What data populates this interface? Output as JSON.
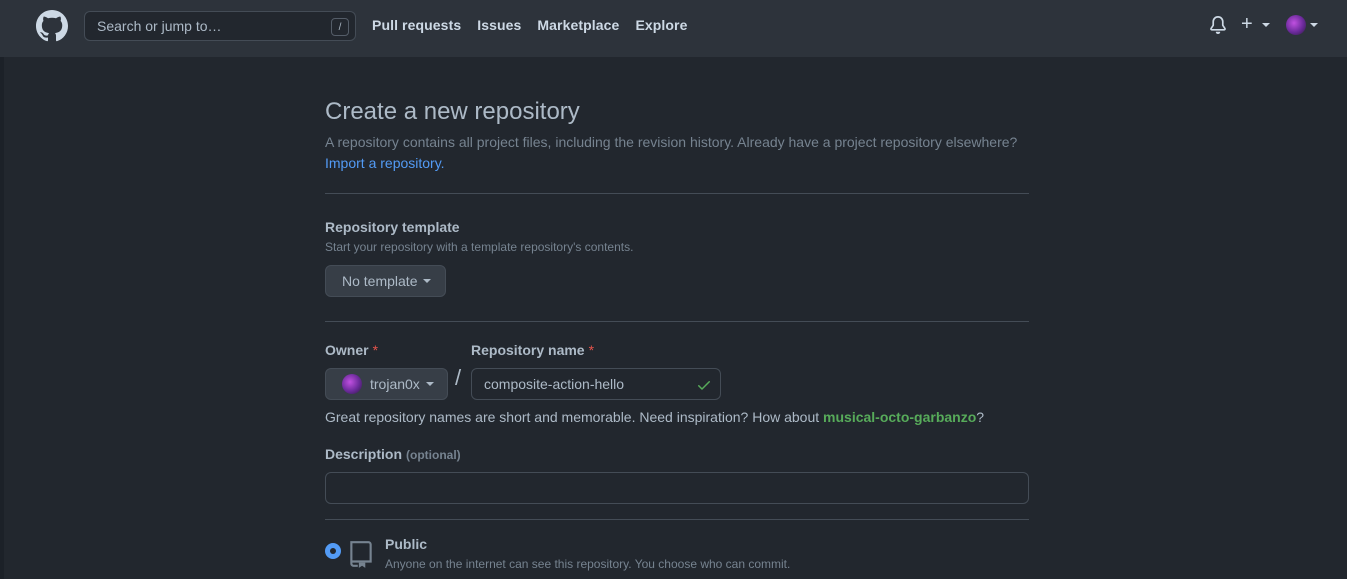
{
  "header": {
    "search_placeholder": "Search or jump to…",
    "search_shortcut": "/",
    "nav": [
      "Pull requests",
      "Issues",
      "Marketplace",
      "Explore"
    ],
    "plus": "+"
  },
  "page": {
    "title": "Create a new repository",
    "subtitle": "A repository contains all project files, including the revision history. Already have a project repository elsewhere?",
    "import_link": "Import a repository."
  },
  "template": {
    "label": "Repository template",
    "note": "Start your repository with a template repository's contents.",
    "button": "No template"
  },
  "owner": {
    "label": "Owner",
    "required_mark": "*",
    "value": "trojan0x",
    "separator": "/"
  },
  "repo_name": {
    "label": "Repository name",
    "required_mark": "*",
    "value": "composite-action-hello"
  },
  "hint": {
    "prefix": "Great repository names are short and memorable. Need inspiration? How about ",
    "suggestion": "musical-octo-garbanzo",
    "suffix": "?"
  },
  "description": {
    "label": "Description",
    "optional": "(optional)",
    "value": ""
  },
  "visibility": {
    "public_label": "Public",
    "public_note": "Anyone on the internet can see this repository. You choose who can commit."
  },
  "colors": {
    "background": "#22272e",
    "header": "#2d333b",
    "link": "#539bf5",
    "success": "#57ab5a",
    "danger": "#e5534b"
  },
  "icons": [
    "github-logo-icon",
    "bell-icon",
    "plus-icon",
    "caret-down-icon",
    "check-icon",
    "repo-icon"
  ]
}
